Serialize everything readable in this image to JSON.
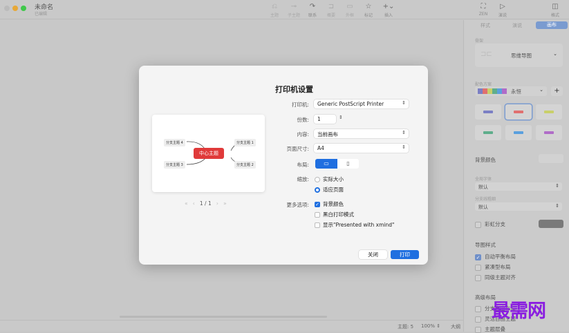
{
  "window": {
    "title": "未命名",
    "subtitle": "已编辑"
  },
  "toolbar": {
    "items": [
      {
        "icon": "topic-icon",
        "label": "主题",
        "enabled": false
      },
      {
        "icon": "subtopic-icon",
        "label": "子主题",
        "enabled": false
      },
      {
        "icon": "relationship-icon",
        "label": "联系",
        "enabled": true
      },
      {
        "icon": "summary-icon",
        "label": "概要",
        "enabled": false
      },
      {
        "icon": "boundary-icon",
        "label": "外框",
        "enabled": false
      },
      {
        "icon": "marker-icon",
        "label": "标记",
        "enabled": true
      },
      {
        "icon": "insert-icon",
        "label": "插入",
        "enabled": true
      }
    ],
    "right": [
      {
        "icon": "zen-icon",
        "label": "ZEN"
      },
      {
        "icon": "present-icon",
        "label": "演说"
      },
      {
        "icon": "format-icon",
        "label": "格式"
      }
    ]
  },
  "sidebar": {
    "tabs": [
      "样式",
      "演说",
      "画布"
    ],
    "active_tab": "画布",
    "skeleton_label": "骨架",
    "skeleton_value": "思维导图",
    "color_scheme_label": "配色方案",
    "color_scheme_value": "永恒",
    "scheme_colors": [
      "#7b7fc4",
      "#e0706f",
      "#c9cf6a",
      "#5fae8c",
      "#5aa0de",
      "#b06cc8"
    ],
    "bg_color_label": "背景颜色",
    "font_label": "全局字体",
    "font_value": "默认",
    "branch_label": "分支线粗细",
    "branch_value": "默认",
    "rainbow_label": "彩虹分支",
    "map_style_title": "导图样式",
    "map_style_options": [
      {
        "label": "自动平衡布局",
        "checked": true
      },
      {
        "label": "紧凑型布局",
        "checked": false
      },
      {
        "label": "同级主题对齐",
        "checked": false
      }
    ],
    "advanced_title": "高级布局",
    "advanced_options": [
      {
        "label": "分支自由布局",
        "checked": false
      },
      {
        "label": "灵活自由主题",
        "checked": false
      },
      {
        "label": "主题层叠",
        "checked": false
      }
    ]
  },
  "status": {
    "topics": "主题: 5",
    "zoom": "100%",
    "outline": "大纲"
  },
  "dialog": {
    "title": "打印机设置",
    "printer_label": "打印机:",
    "printer_value": "Generic PostScript Printer",
    "copies_label": "份数:",
    "copies_value": "1",
    "content_label": "内容:",
    "content_value": "当前画布",
    "page_size_label": "页面尺寸:",
    "page_size_value": "A4",
    "layout_label": "布局:",
    "layout_value": "landscape",
    "scale_label": "缩放:",
    "scale_options": [
      {
        "label": "实际大小",
        "selected": false
      },
      {
        "label": "适应页面",
        "selected": true
      }
    ],
    "more_label": "更多选项:",
    "more_options": [
      {
        "label": "背景颜色",
        "checked": true
      },
      {
        "label": "黑白打印模式",
        "checked": false
      },
      {
        "label": "显示\"Presented with xmind\"",
        "checked": false
      }
    ],
    "close_label": "关闭",
    "print_label": "打印",
    "page_indicator": "1 / 1",
    "preview": {
      "central": "中心主题",
      "branches": [
        "分支主题 1",
        "分支主题 2",
        "分支主题 3",
        "分支主题 4"
      ]
    }
  },
  "watermark": "最需网"
}
